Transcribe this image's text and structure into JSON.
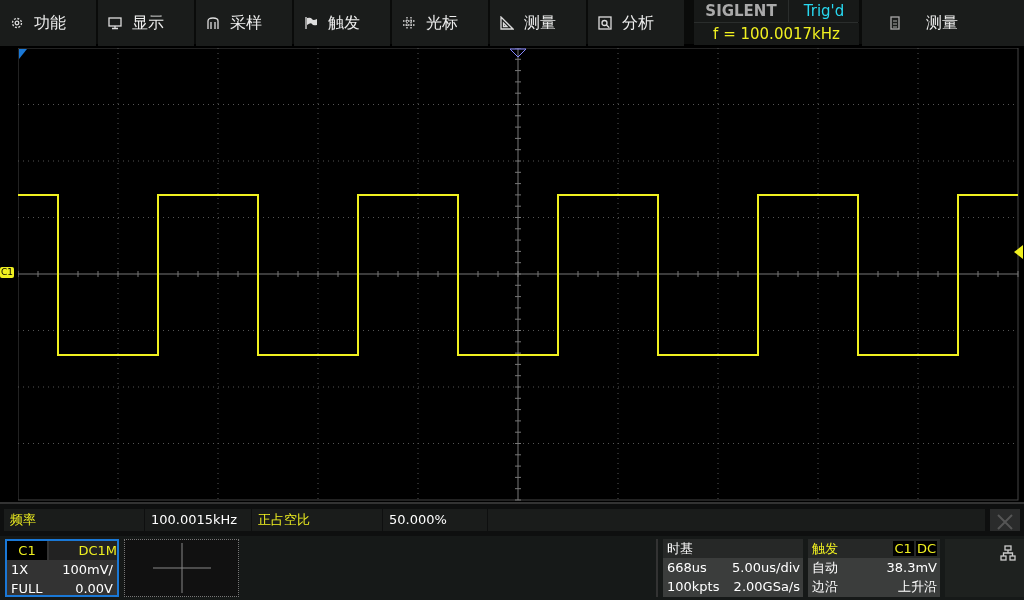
{
  "menu": [
    {
      "kind": "gear",
      "label": "功能"
    },
    {
      "kind": "monitor",
      "label": "显示"
    },
    {
      "kind": "acquire",
      "label": "采样"
    },
    {
      "kind": "flag",
      "label": "触发"
    },
    {
      "kind": "cursor",
      "label": "光标"
    },
    {
      "kind": "ruler",
      "label": "测量"
    },
    {
      "kind": "analyze",
      "label": "分析"
    }
  ],
  "brand": {
    "logo": "SIGLENT",
    "status": "Trig'd",
    "frequency": "f = 100.0017kHz"
  },
  "side_menu": {
    "label": "测量"
  },
  "channel_marker": "C1",
  "measurements": [
    {
      "name": "频率",
      "value": "100.0015kHz"
    },
    {
      "name": "正占空比",
      "value": "50.000%"
    }
  ],
  "channel": {
    "name": "C1",
    "coupling": "DC1M",
    "probe": "1X",
    "scale": "100mV/",
    "bandwidth": "FULL",
    "offset": "0.00V",
    "selected": true
  },
  "timebase": {
    "title": "时基",
    "delay": "668us",
    "scale": "5.00us/div",
    "depth": "100kpts",
    "sample_rate": "2.00GSa/s"
  },
  "trigger": {
    "title": "触发",
    "source": "C1",
    "coupling": "DC",
    "mode": "自动",
    "level": "38.3mV",
    "type": "边沿",
    "slope": "上升沿"
  }
}
